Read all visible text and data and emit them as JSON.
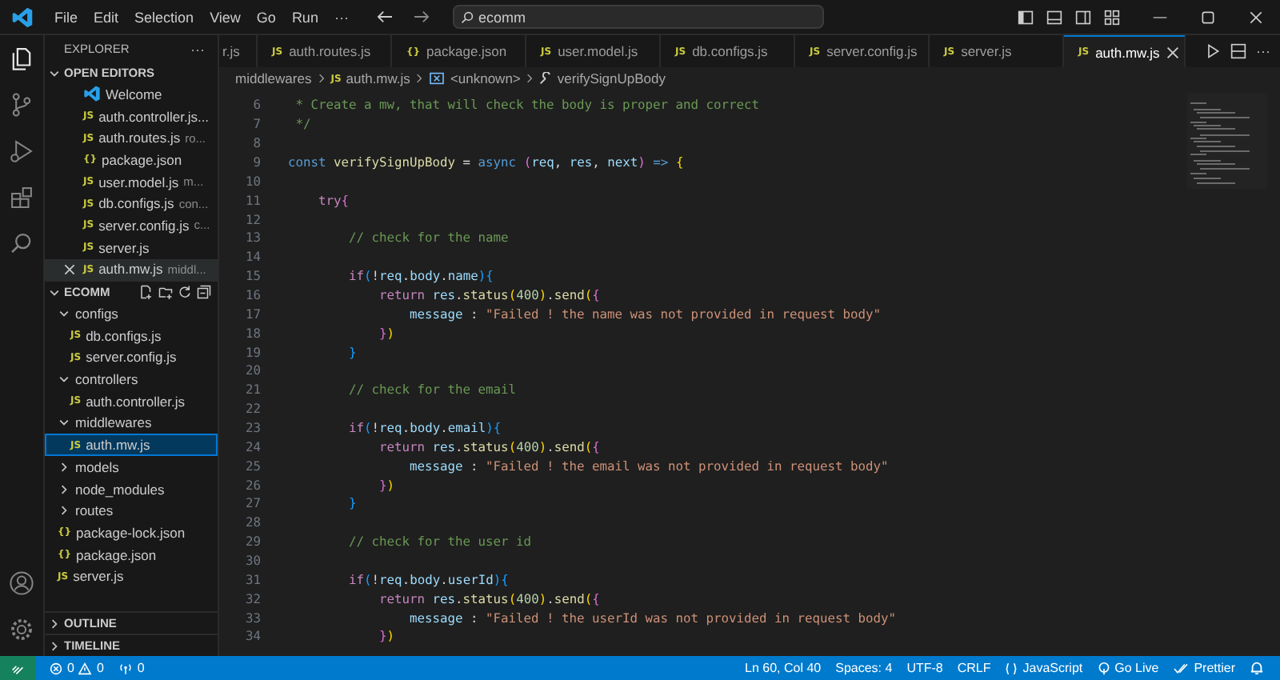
{
  "menu": [
    "File",
    "Edit",
    "Selection",
    "View",
    "Go",
    "Run",
    "···"
  ],
  "search": {
    "value": "ecomm"
  },
  "sidebar": {
    "title": "EXPLORER",
    "more": "···",
    "sections": [
      {
        "label": "OPEN EDITORS",
        "expanded": true,
        "kind": "editors",
        "items": [
          {
            "kind": "vscode",
            "name": "Welcome",
            "selected": false
          },
          {
            "icon": "JS",
            "name": "auth.controller.js...",
            "selected": false
          },
          {
            "icon": "JS",
            "name": "auth.routes.js",
            "hint": "ro...",
            "selected": false
          },
          {
            "icon": "{}",
            "name": "package.json",
            "selected": false
          },
          {
            "icon": "JS",
            "name": "user.model.js",
            "hint": "m...",
            "selected": false
          },
          {
            "icon": "JS",
            "name": "db.configs.js",
            "hint": "con...",
            "selected": false
          },
          {
            "icon": "JS",
            "name": "server.config.js",
            "hint": "c...",
            "selected": false
          },
          {
            "icon": "JS",
            "name": "server.js",
            "selected": false
          },
          {
            "icon": "JS",
            "name": "auth.mw.js",
            "hint": "middl...",
            "selected": true
          }
        ]
      },
      {
        "label": "ECOMM",
        "expanded": true,
        "kind": "tree",
        "items": [
          {
            "name": "configs",
            "kind": "folder",
            "expanded": true,
            "children": [
              {
                "icon": "JS",
                "name": "db.configs.js",
                "kind": "file",
                "selected": false
              },
              {
                "icon": "JS",
                "name": "server.config.js",
                "kind": "file",
                "selected": false
              }
            ]
          },
          {
            "name": "controllers",
            "kind": "folder",
            "expanded": true,
            "children": [
              {
                "icon": "JS",
                "name": "auth.controller.js",
                "kind": "file",
                "selected": false
              }
            ]
          },
          {
            "name": "middlewares",
            "kind": "folder",
            "expanded": true,
            "children": [
              {
                "icon": "JS",
                "name": "auth.mw.js",
                "kind": "file",
                "selected": true
              }
            ]
          },
          {
            "name": "models",
            "kind": "folder",
            "expanded": false
          },
          {
            "name": "node_modules",
            "kind": "folder",
            "expanded": false
          },
          {
            "name": "routes",
            "kind": "folder",
            "expanded": false
          },
          {
            "icon": "{}",
            "name": "package-lock.json",
            "kind": "file",
            "selected": false
          },
          {
            "icon": "{}",
            "name": "package.json",
            "kind": "file",
            "selected": false
          },
          {
            "icon": "JS",
            "name": "server.js",
            "kind": "file",
            "selected": false
          }
        ]
      },
      {
        "label": "OUTLINE",
        "expanded": false,
        "kind": "panel"
      },
      {
        "label": "TIMELINE",
        "expanded": false,
        "kind": "panel"
      }
    ]
  },
  "tabs": [
    {
      "label": "r.js",
      "selected": false
    },
    {
      "icon": "JS",
      "label": "auth.routes.js",
      "selected": false
    },
    {
      "icon": "{}",
      "label": "package.json",
      "selected": false
    },
    {
      "icon": "JS",
      "label": "user.model.js",
      "selected": false
    },
    {
      "icon": "JS",
      "label": "db.configs.js",
      "selected": false
    },
    {
      "icon": "JS",
      "label": "server.config.js",
      "selected": false
    },
    {
      "icon": "JS",
      "label": "server.js",
      "selected": false
    },
    {
      "icon": "JS",
      "label": "auth.mw.js",
      "selected": true
    }
  ],
  "breadcrumb": [
    {
      "label": "middlewares",
      "kind": "folder"
    },
    {
      "icon": "JS",
      "label": "auth.mw.js",
      "kind": "file"
    },
    {
      "label": "<unknown>",
      "kind": "variable"
    },
    {
      "label": "verifySignUpBody",
      "kind": "method"
    }
  ],
  "code": [
    {
      "n": "6",
      "tokens": [
        {
          "t": " * Create a mw, that will check the body is proper and correct",
          "kind": "comment"
        }
      ]
    },
    {
      "n": "7",
      "tokens": [
        {
          "t": " */",
          "kind": "comment"
        }
      ]
    },
    {
      "n": "8"
    },
    {
      "n": "9",
      "tokens": [
        {
          "t": "const ",
          "kind": "keyword"
        },
        {
          "t": "verifySignUpBody",
          "kind": "function"
        },
        {
          "t": " = ",
          "kind": "plain"
        },
        {
          "t": "async ",
          "kind": "keyword"
        },
        {
          "t": "(",
          "kind": "bracket2"
        },
        {
          "t": "req",
          "kind": "variable"
        },
        {
          "t": ", ",
          "kind": "plain"
        },
        {
          "t": "res",
          "kind": "variable"
        },
        {
          "t": ", ",
          "kind": "plain"
        },
        {
          "t": "next",
          "kind": "variable"
        },
        {
          "t": ")",
          "kind": "bracket2"
        },
        {
          "t": " => ",
          "kind": "keyword"
        },
        {
          "t": "{",
          "kind": "bracket1"
        }
      ]
    },
    {
      "n": "10"
    },
    {
      "n": "11",
      "tokens": [
        {
          "t": "    try",
          "kind": "control"
        },
        {
          "t": "{",
          "kind": "bracket2"
        }
      ]
    },
    {
      "n": "12"
    },
    {
      "n": "13",
      "tokens": [
        {
          "t": "        // check for the name",
          "kind": "comment"
        }
      ]
    },
    {
      "n": "14"
    },
    {
      "n": "15",
      "tokens": [
        {
          "t": "        if",
          "kind": "control"
        },
        {
          "t": "(",
          "kind": "bracket3"
        },
        {
          "t": "!",
          "kind": "plain"
        },
        {
          "t": "req",
          "kind": "variable"
        },
        {
          "t": ".",
          "kind": "plain"
        },
        {
          "t": "body",
          "kind": "variable"
        },
        {
          "t": ".",
          "kind": "plain"
        },
        {
          "t": "name",
          "kind": "variable"
        },
        {
          "t": ")",
          "kind": "bracket3"
        },
        {
          "t": "{",
          "kind": "bracket3"
        }
      ]
    },
    {
      "n": "16",
      "tokens": [
        {
          "t": "            return ",
          "kind": "control"
        },
        {
          "t": "res",
          "kind": "variable"
        },
        {
          "t": ".",
          "kind": "plain"
        },
        {
          "t": "status",
          "kind": "function"
        },
        {
          "t": "(",
          "kind": "bracket1"
        },
        {
          "t": "400",
          "kind": "number"
        },
        {
          "t": ")",
          "kind": "bracket1"
        },
        {
          "t": ".",
          "kind": "plain"
        },
        {
          "t": "send",
          "kind": "function"
        },
        {
          "t": "(",
          "kind": "bracket1"
        },
        {
          "t": "{",
          "kind": "bracket2"
        }
      ]
    },
    {
      "n": "17",
      "tokens": [
        {
          "t": "                message",
          "kind": "variable"
        },
        {
          "t": " : ",
          "kind": "plain"
        },
        {
          "t": "\"Failed ! the name was not provided in request body\"",
          "kind": "string"
        }
      ]
    },
    {
      "n": "18",
      "tokens": [
        {
          "t": "            }",
          "kind": "bracket2"
        },
        {
          "t": ")",
          "kind": "bracket1"
        }
      ]
    },
    {
      "n": "19",
      "tokens": [
        {
          "t": "        }",
          "kind": "bracket3"
        }
      ]
    },
    {
      "n": "20"
    },
    {
      "n": "21",
      "tokens": [
        {
          "t": "        // check for the email",
          "kind": "comment"
        }
      ]
    },
    {
      "n": "22"
    },
    {
      "n": "23",
      "tokens": [
        {
          "t": "        if",
          "kind": "control"
        },
        {
          "t": "(",
          "kind": "bracket3"
        },
        {
          "t": "!",
          "kind": "plain"
        },
        {
          "t": "req",
          "kind": "variable"
        },
        {
          "t": ".",
          "kind": "plain"
        },
        {
          "t": "body",
          "kind": "variable"
        },
        {
          "t": ".",
          "kind": "plain"
        },
        {
          "t": "email",
          "kind": "variable"
        },
        {
          "t": ")",
          "kind": "bracket3"
        },
        {
          "t": "{",
          "kind": "bracket3"
        }
      ]
    },
    {
      "n": "24",
      "tokens": [
        {
          "t": "            return ",
          "kind": "control"
        },
        {
          "t": "res",
          "kind": "variable"
        },
        {
          "t": ".",
          "kind": "plain"
        },
        {
          "t": "status",
          "kind": "function"
        },
        {
          "t": "(",
          "kind": "bracket1"
        },
        {
          "t": "400",
          "kind": "number"
        },
        {
          "t": ")",
          "kind": "bracket1"
        },
        {
          "t": ".",
          "kind": "plain"
        },
        {
          "t": "send",
          "kind": "function"
        },
        {
          "t": "(",
          "kind": "bracket1"
        },
        {
          "t": "{",
          "kind": "bracket2"
        }
      ]
    },
    {
      "n": "25",
      "tokens": [
        {
          "t": "                message",
          "kind": "variable"
        },
        {
          "t": " : ",
          "kind": "plain"
        },
        {
          "t": "\"Failed ! the email was not provided in request body\"",
          "kind": "string"
        }
      ]
    },
    {
      "n": "26",
      "tokens": [
        {
          "t": "            }",
          "kind": "bracket2"
        },
        {
          "t": ")",
          "kind": "bracket1"
        }
      ]
    },
    {
      "n": "27",
      "tokens": [
        {
          "t": "        }",
          "kind": "bracket3"
        }
      ]
    },
    {
      "n": "28"
    },
    {
      "n": "29",
      "tokens": [
        {
          "t": "        // check for the user id",
          "kind": "comment"
        }
      ]
    },
    {
      "n": "30"
    },
    {
      "n": "31",
      "tokens": [
        {
          "t": "        if",
          "kind": "control"
        },
        {
          "t": "(",
          "kind": "bracket3"
        },
        {
          "t": "!",
          "kind": "plain"
        },
        {
          "t": "req",
          "kind": "variable"
        },
        {
          "t": ".",
          "kind": "plain"
        },
        {
          "t": "body",
          "kind": "variable"
        },
        {
          "t": ".",
          "kind": "plain"
        },
        {
          "t": "userId",
          "kind": "variable"
        },
        {
          "t": ")",
          "kind": "bracket3"
        },
        {
          "t": "{",
          "kind": "bracket3"
        }
      ]
    },
    {
      "n": "32",
      "tokens": [
        {
          "t": "            return ",
          "kind": "control"
        },
        {
          "t": "res",
          "kind": "variable"
        },
        {
          "t": ".",
          "kind": "plain"
        },
        {
          "t": "status",
          "kind": "function"
        },
        {
          "t": "(",
          "kind": "bracket1"
        },
        {
          "t": "400",
          "kind": "number"
        },
        {
          "t": ")",
          "kind": "bracket1"
        },
        {
          "t": ".",
          "kind": "plain"
        },
        {
          "t": "send",
          "kind": "function"
        },
        {
          "t": "(",
          "kind": "bracket1"
        },
        {
          "t": "{",
          "kind": "bracket2"
        }
      ]
    },
    {
      "n": "33",
      "tokens": [
        {
          "t": "                message",
          "kind": "variable"
        },
        {
          "t": " : ",
          "kind": "plain"
        },
        {
          "t": "\"Failed ! the userId was not provided in request body\"",
          "kind": "string"
        }
      ]
    },
    {
      "n": "34",
      "tokens": [
        {
          "t": "            }",
          "kind": "bracket2"
        },
        {
          "t": ")",
          "kind": "bracket1"
        }
      ]
    }
  ],
  "status_bar": {
    "errors": "0",
    "warnings": "0",
    "ports": "0",
    "right": [
      {
        "label": "Ln 60, Col 40",
        "kind": "text"
      },
      {
        "label": "Spaces: 4",
        "kind": "text"
      },
      {
        "label": "UTF-8",
        "kind": "text"
      },
      {
        "label": "CRLF",
        "kind": "text"
      },
      {
        "label": "JavaScript",
        "kind": "language"
      },
      {
        "label": "Go Live",
        "kind": "live"
      },
      {
        "label": "Prettier",
        "kind": "check"
      },
      {
        "kind": "bell"
      }
    ]
  }
}
